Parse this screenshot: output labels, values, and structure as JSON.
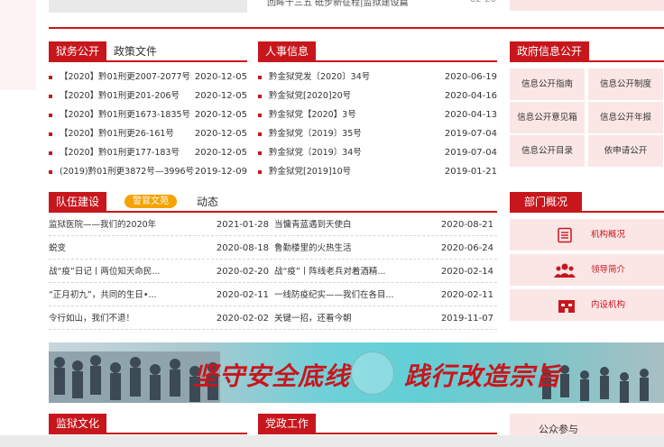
{
  "top": {
    "snippet_text": "回眸十三五 砥步新征程|监狱建设篇",
    "snippet_date": "02-20"
  },
  "prison_affairs": {
    "tab_active": "狱务公开",
    "tab_other": "政策文件",
    "items": [
      {
        "title": "【2020】黔01刑更2007-2077号",
        "date": "2020-12-05"
      },
      {
        "title": "【2020】黔01刑更201-206号",
        "date": "2020-12-05"
      },
      {
        "title": "【2020】黔01刑更1673-1835号",
        "date": "2020-12-05"
      },
      {
        "title": "【2020】黔01刑更26-161号",
        "date": "2020-12-05"
      },
      {
        "title": "【2020】黔01刑更177-183号",
        "date": "2020-12-05"
      },
      {
        "title": "(2019)黔01刑更3872号—3996号",
        "date": "2019-12-09"
      }
    ]
  },
  "personnel": {
    "tab_active": "人事信息",
    "items": [
      {
        "title": "黔金狱党发〔2020〕34号",
        "date": "2020-06-19"
      },
      {
        "title": "黔金狱党[2020]20号",
        "date": "2020-04-16"
      },
      {
        "title": "黔金狱党【2020】3号",
        "date": "2020-04-13"
      },
      {
        "title": "黔金狱党〔2019〕35号",
        "date": "2019-07-04"
      },
      {
        "title": "黔金狱党〔2019〕34号",
        "date": "2019-07-04"
      },
      {
        "title": "黔金狱党[2019]10号",
        "date": "2019-01-21"
      }
    ]
  },
  "gov_info": {
    "title": "政府信息公开",
    "cells": [
      "信息公开指南",
      "信息公开制度",
      "信息公开意见箱",
      "信息公开年报",
      "信息公开目录",
      "依申请公开"
    ]
  },
  "team": {
    "tab_active": "队伍建设",
    "tab_pill": "警官文苑",
    "tab_other": "动态",
    "left_items": [
      {
        "title": "监狱医院——我们的2020年",
        "date": "2021-01-28"
      },
      {
        "title": "蜕变",
        "date": "2020-08-18"
      },
      {
        "title": "战“疫”日记丨两位知天命民...",
        "date": "2020-02-20"
      },
      {
        "title": "“正月初九”，共同的生日•...",
        "date": "2020-02-11"
      },
      {
        "title": "令行如山，我们不退！",
        "date": "2020-02-02"
      }
    ],
    "right_items": [
      {
        "title": "当慵青蓝遇到天使白",
        "date": "2020-08-21"
      },
      {
        "title": "鲁勤楼里的火热生活",
        "date": "2020-06-24"
      },
      {
        "title": "战“疫”丨阵线老兵对着酒精...",
        "date": "2020-02-14"
      },
      {
        "title": "一线防疫纪实——我们在各目...",
        "date": "2020-02-11"
      },
      {
        "title": "关键一招，还看今朝",
        "date": "2019-11-07"
      }
    ]
  },
  "dept": {
    "title": "部门概况",
    "items": [
      {
        "label": "机构概况",
        "icon": "document-list-icon"
      },
      {
        "label": "领导简介",
        "icon": "people-group-icon"
      },
      {
        "label": "内设机构",
        "icon": "building-icon"
      }
    ]
  },
  "banner": {
    "slogan_left": "坚守安全底线",
    "slogan_right": "践行改造宗旨"
  },
  "bottom": {
    "culture": "监狱文化",
    "party": "党政工作",
    "public": "公众参与"
  },
  "colors": {
    "brand_red": "#c8161d",
    "pill_orange": "#f5a300",
    "pink_bg": "#fbe6e6",
    "banner_teal": "#5fc8cf"
  }
}
